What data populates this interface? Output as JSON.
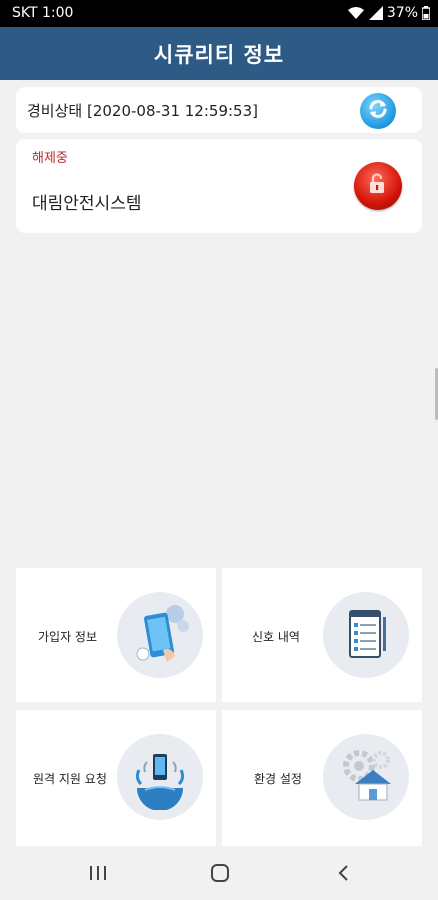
{
  "status_bar": {
    "carrier_time": "SKT 1:00",
    "battery": "37%"
  },
  "header": {
    "title": "시큐리티 정보"
  },
  "security_status": {
    "text": "경비상태 [2020-08-31 12:59:53]"
  },
  "system": {
    "state": "해제중",
    "name": "대림안전시스템"
  },
  "menu": [
    {
      "label": "가입자 정보",
      "icon": "subscriber-phone-icon"
    },
    {
      "label": "신호 내역",
      "icon": "signal-history-notepad-icon"
    },
    {
      "label": "원격 지원 요청",
      "icon": "remote-support-globe-icon"
    },
    {
      "label": "환경 설정",
      "icon": "settings-house-gear-icon"
    }
  ],
  "colors": {
    "header": "#2e5a86",
    "disarmed_text": "#c0282d",
    "refresh": "#1d97e0",
    "lock": "#d41408"
  }
}
